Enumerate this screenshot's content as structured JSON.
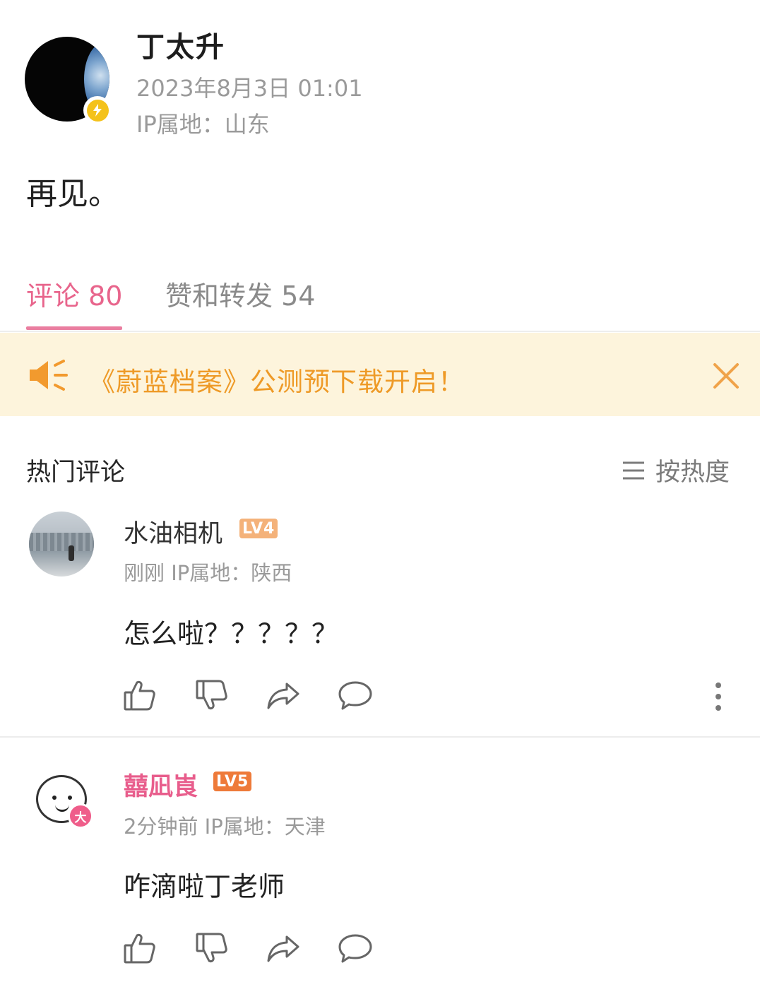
{
  "post": {
    "author_name": "丁太升",
    "time": "2023年8月3日 01:01",
    "ip_location": "IP属地：山东",
    "content": "再见。"
  },
  "tabs": [
    {
      "label": "评论 80",
      "active": true
    },
    {
      "label": "赞和转发 54",
      "active": false
    }
  ],
  "notice": {
    "text": "《蔚蓝档案》公测预下载开启！",
    "icon": "megaphone-icon",
    "close_icon": "close-icon"
  },
  "comments_section": {
    "title": "热门评论",
    "sort_label": "按热度",
    "sort_icon": "menu-icon"
  },
  "comments": [
    {
      "user": "水油相机",
      "level": "LV4",
      "meta": "刚刚  IP属地：陕西",
      "text": "怎么啦？？？？？"
    },
    {
      "user": "囍凪崀",
      "level": "LV5",
      "avatar_badge": "大",
      "meta": "2分钟前  IP属地：天津",
      "text": "咋滴啦丁老师"
    }
  ],
  "colors": {
    "accent_pink": "#e8658c",
    "notice_bg": "#fdf4dc",
    "notice_text": "#ee9a27",
    "verify_gold": "#f4c21b"
  }
}
